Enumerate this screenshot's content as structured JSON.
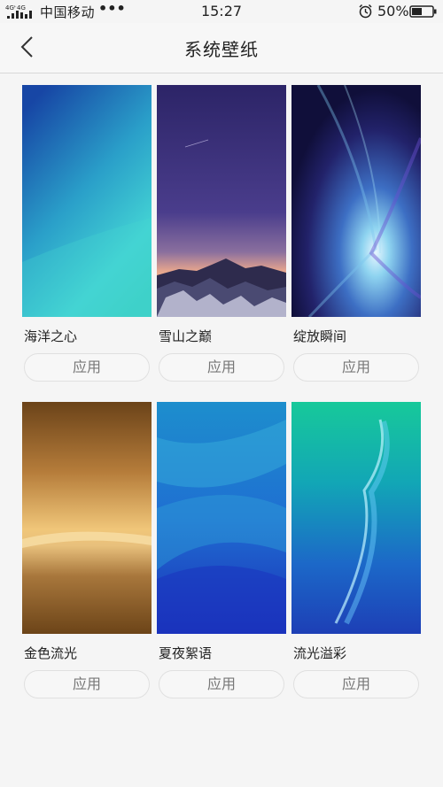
{
  "status_bar": {
    "network": "4G⁺4G",
    "carrier": "中国移动",
    "more": "•••",
    "time": "15:27",
    "battery": "50%"
  },
  "nav": {
    "back_icon": "chevron-left-icon",
    "title": "系统壁纸"
  },
  "wallpapers": [
    {
      "name": "海洋之心",
      "apply": "应用"
    },
    {
      "name": "雪山之巅",
      "apply": "应用"
    },
    {
      "name": "绽放瞬间",
      "apply": "应用"
    },
    {
      "name": "金色流光",
      "apply": "应用"
    },
    {
      "name": "夏夜絮语",
      "apply": "应用"
    },
    {
      "name": "流光溢彩",
      "apply": "应用"
    }
  ],
  "colors": {
    "background": "#f5f5f5",
    "text": "#222222",
    "button_text": "#777777",
    "divider": "#d8d8d8"
  }
}
